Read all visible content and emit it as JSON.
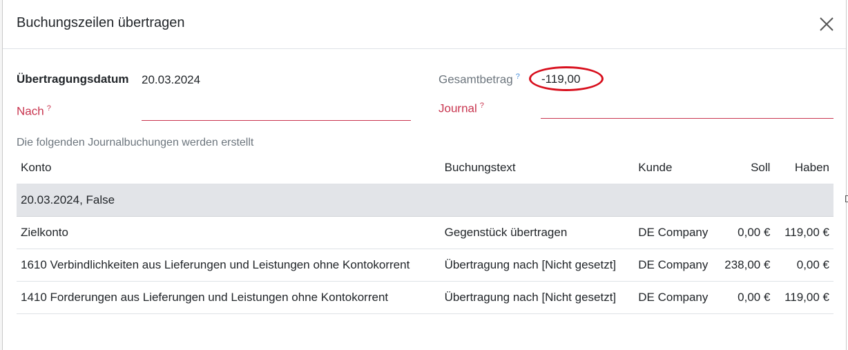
{
  "dialog": {
    "title": "Buchungszeilen übertragen"
  },
  "form": {
    "date_label": "Übertragungsdatum",
    "date_value": "20.03.2024",
    "to_label": "Nach",
    "to_help": "?",
    "total_label": "Gesamtbetrag",
    "total_help": "?",
    "total_value": "-119,00",
    "journal_label": "Journal",
    "journal_help": "?"
  },
  "hint": "Die folgenden Journalbuchungen werden erstellt",
  "table": {
    "headers": {
      "konto": "Konto",
      "buchungstext": "Buchungstext",
      "kunde": "Kunde",
      "soll": "Soll",
      "haben": "Haben"
    },
    "group": "20.03.2024, False",
    "rows": [
      {
        "konto": "Zielkonto",
        "buchungstext": "Gegenstück übertragen",
        "kunde": "DE Company",
        "soll": "0,00 €",
        "haben": "119,00 €"
      },
      {
        "konto": "1610 Verbindlichkeiten aus Lieferungen und Leistungen ohne Kontokorrent",
        "buchungstext": "Übertragung nach [Nicht gesetzt]",
        "kunde": "DE Company",
        "soll": "238,00 €",
        "haben": "0,00 €"
      },
      {
        "konto": "1410 Forderungen aus Lieferungen und Leistungen ohne Kontokorrent",
        "buchungstext": "Übertragung nach [Nicht gesetzt]",
        "kunde": "DE Company",
        "soll": "0,00 €",
        "haben": "119,00 €"
      }
    ]
  },
  "colors": {
    "required_label": "#c8344e",
    "annotation_circle": "#d80f1d",
    "group_row_bg": "#e2e4e8"
  }
}
